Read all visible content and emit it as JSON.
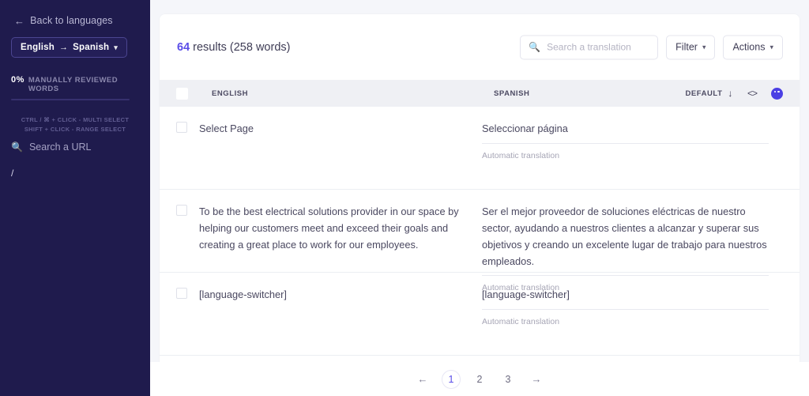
{
  "sidebar": {
    "back_label": "Back to languages",
    "back_icon": "arrow-left-icon",
    "language_pair": {
      "source": "English",
      "arrow": "→",
      "target": "Spanish",
      "caret": "⌄"
    },
    "reviewed": {
      "percent": "0%",
      "label": "MANUALLY REVIEWED WORDS",
      "progress_value": 0
    },
    "hints": {
      "line1": "CTRL / ⌘ + CLICK - MULTI SELECT",
      "line2": "SHIFT + CLICK - RANGE SELECT"
    },
    "search_url": {
      "icon": "search-icon",
      "placeholder": "Search a URL"
    },
    "urls": [
      {
        "label": "/"
      }
    ]
  },
  "header": {
    "results_count": "64",
    "results_text": " results (258 words)",
    "search": {
      "icon": "search-icon",
      "placeholder": "Search a translation",
      "value": ""
    },
    "filter_button": {
      "label": "Filter",
      "caret": "⌄"
    },
    "actions_button": {
      "label": "Actions",
      "caret": "⌄"
    }
  },
  "table": {
    "columns": {
      "english": "ENGLISH",
      "spanish": "SPANISH"
    },
    "sort": {
      "label": "DEFAULT",
      "icon": "↓"
    },
    "code_icon": "<>",
    "palette_icon": "palette-icon",
    "rows": [
      {
        "english": "Select Page",
        "spanish": "Seleccionar página",
        "note": "Automatic translation"
      },
      {
        "english": "To be the best electrical solutions provider in our space by helping our customers meet and exceed their goals and creating a great place to work for our employees.",
        "spanish": "Ser el mejor proveedor de soluciones eléctricas de nuestro sector, ayudando a nuestros clientes a alcanzar y superar sus objetivos y creando un excelente lugar de trabajo para nuestros empleados.",
        "note": "Automatic translation"
      },
      {
        "english": "[language-switcher]",
        "spanish": "[language-switcher]",
        "note": "Automatic translation"
      }
    ]
  },
  "pagination": {
    "prev": "←",
    "next": "→",
    "pages": [
      "1",
      "2",
      "3"
    ],
    "current": "1"
  },
  "colors": {
    "sidebar_bg": "#1f1b4d",
    "accent": "#5b4ee8",
    "page_bg": "#f5f6fa"
  }
}
